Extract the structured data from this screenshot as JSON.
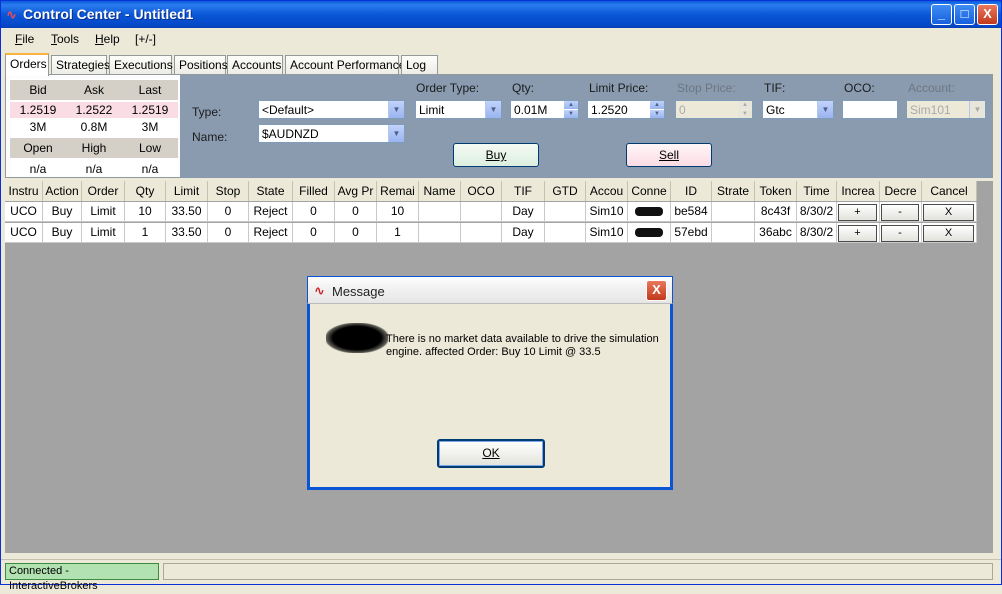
{
  "window": {
    "title": "Control Center - Untitled1",
    "minimize": "_",
    "maximize": "□",
    "close": "X"
  },
  "menu": [
    {
      "label": "File",
      "accel": "F",
      "rest": "ile"
    },
    {
      "label": "Tools",
      "accel": "T",
      "rest": "ools"
    },
    {
      "label": "Help",
      "accel": "H",
      "rest": "elp"
    },
    {
      "label": "[+/-]",
      "accel": "",
      "rest": "[+/-]"
    }
  ],
  "tabs": [
    "Orders",
    "Strategies",
    "Executions",
    "Positions",
    "Accounts",
    "Account Performance",
    "Log"
  ],
  "quote": {
    "headers1": [
      "Bid",
      "Ask",
      "Last"
    ],
    "prices": [
      "1.2519",
      "1.2522",
      "1.2519"
    ],
    "sizes": [
      "3M",
      "0.8M",
      "3M"
    ],
    "headers2": [
      "Open",
      "High",
      "Low"
    ],
    "values2": [
      "n/a",
      "n/a",
      "n/a"
    ]
  },
  "order_entry": {
    "type_label": "Type:",
    "type_value": "<Default>",
    "name_label": "Name:",
    "name_value": "$AUDNZD",
    "order_type_label": "Order Type:",
    "order_type_value": "Limit",
    "qty_label": "Qty:",
    "qty_value": "0.01M",
    "limit_label": "Limit Price:",
    "limit_value": "1.2520",
    "stop_label": "Stop Price:",
    "stop_value": "0",
    "tif_label": "TIF:",
    "tif_value": "Gtc",
    "oco_label": "OCO:",
    "oco_value": "",
    "account_label": "Account:",
    "account_value": "Sim101",
    "buy_label": "Buy",
    "sell_label": "Sell"
  },
  "orders_table": {
    "columns": [
      "Instru",
      "Action",
      "Order",
      "Qty",
      "Limit",
      "Stop",
      "State",
      "Filled",
      "Avg Pr",
      "Remai",
      "Name",
      "OCO",
      "TIF",
      "GTD",
      "Accou",
      "Conne",
      "ID",
      "Strate",
      "Token",
      "Time",
      "Increa",
      "Decre",
      "Cancel"
    ],
    "rows": [
      [
        "UCO",
        "Buy",
        "Limit",
        "10",
        "33.50",
        "0",
        "Reject",
        "0",
        "0",
        "10",
        "",
        "",
        "Day",
        "",
        "Sim10",
        "",
        "be584",
        "",
        "8c43f",
        "8/30/2",
        "+",
        "-",
        "X"
      ],
      [
        "UCO",
        "Buy",
        "Limit",
        "1",
        "33.50",
        "0",
        "Reject",
        "0",
        "0",
        "1",
        "",
        "",
        "Day",
        "",
        "Sim10",
        "",
        "57ebd",
        "",
        "36abc",
        "8/30/2",
        "+",
        "-",
        "X"
      ]
    ]
  },
  "dialog": {
    "title": "Message",
    "message": "There is no market data available to drive the simulation engine. affected Order: Buy 10 Limit @ 33.5",
    "ok_label": "OK",
    "close": "X"
  },
  "status": {
    "connection": "Connected - InteractiveBrokers"
  },
  "colors": {
    "titlebar": "#0a57d6",
    "status_ok": "#b2e2b2",
    "bid_row": "#f9dce4",
    "panel": "#8a9bb0"
  }
}
